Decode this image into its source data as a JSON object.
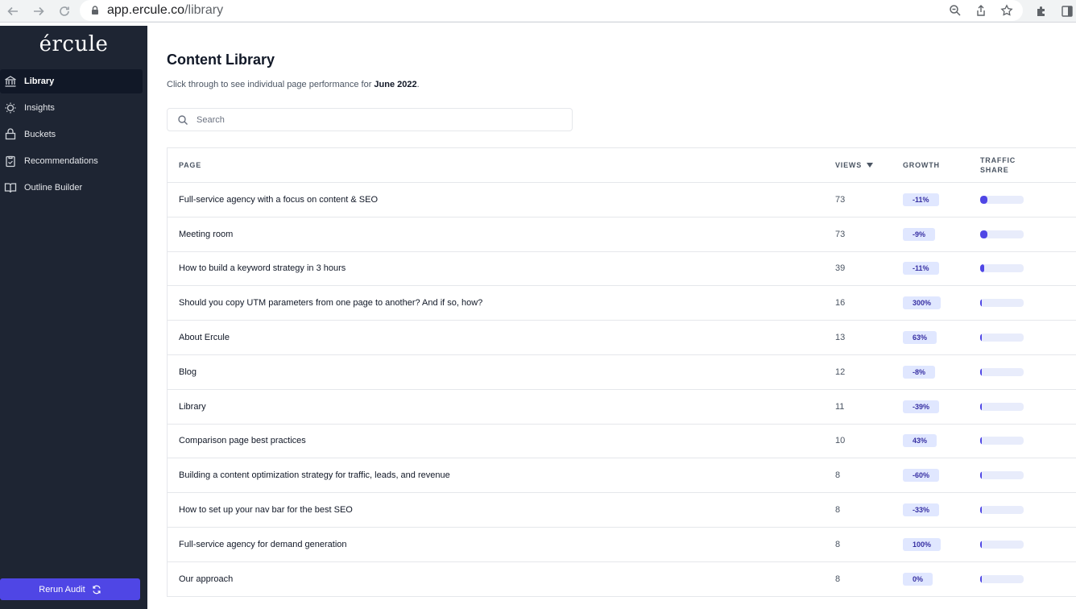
{
  "browser": {
    "url_host": "app.ercule.co",
    "url_path": "/library"
  },
  "sidebar": {
    "logo": "ércule",
    "items": [
      {
        "label": "Library",
        "icon": "bank-icon"
      },
      {
        "label": "Insights",
        "icon": "lightbulb-icon"
      },
      {
        "label": "Buckets",
        "icon": "bucket-icon"
      },
      {
        "label": "Recommendations",
        "icon": "clipboard-icon"
      },
      {
        "label": "Outline Builder",
        "icon": "book-icon"
      }
    ],
    "rerun_label": "Rerun Audit"
  },
  "main": {
    "title": "Content Library",
    "subtitle_prefix": "Click through to see individual page performance for ",
    "subtitle_period": "June 2022",
    "subtitle_suffix": ".",
    "search_placeholder": "Search"
  },
  "table": {
    "headers": {
      "page": "PAGE",
      "views": "VIEWS",
      "growth": "GROWTH",
      "share_line1": "TRAFFIC",
      "share_line2": "SHARE"
    },
    "rows": [
      {
        "page": "Full-service agency with a focus on content & SEO",
        "views": "73",
        "growth": "-11%",
        "share": 0.17
      },
      {
        "page": "Meeting room",
        "views": "73",
        "growth": "-9%",
        "share": 0.17
      },
      {
        "page": "How to build a keyword strategy in 3 hours",
        "views": "39",
        "growth": "-11%",
        "share": 0.09
      },
      {
        "page": "Should you copy UTM parameters from one page to another? And if so, how?",
        "views": "16",
        "growth": "300%",
        "share": 0.04
      },
      {
        "page": "About Ercule",
        "views": "13",
        "growth": "63%",
        "share": 0.03
      },
      {
        "page": "Blog",
        "views": "12",
        "growth": "-8%",
        "share": 0.03
      },
      {
        "page": "Library",
        "views": "11",
        "growth": "-39%",
        "share": 0.03
      },
      {
        "page": "Comparison page best practices",
        "views": "10",
        "growth": "43%",
        "share": 0.02
      },
      {
        "page": "Building a content optimization strategy for traffic, leads, and revenue",
        "views": "8",
        "growth": "-60%",
        "share": 0.02
      },
      {
        "page": "How to set up your nav bar for the best SEO",
        "views": "8",
        "growth": "-33%",
        "share": 0.02
      },
      {
        "page": "Full-service agency for demand generation",
        "views": "8",
        "growth": "100%",
        "share": 0.02
      },
      {
        "page": "Our approach",
        "views": "8",
        "growth": "0%",
        "share": 0.02
      }
    ]
  },
  "colors": {
    "sidebar_bg": "#1e2533",
    "accent": "#4f46e5",
    "badge_bg": "#e0e7ff"
  }
}
